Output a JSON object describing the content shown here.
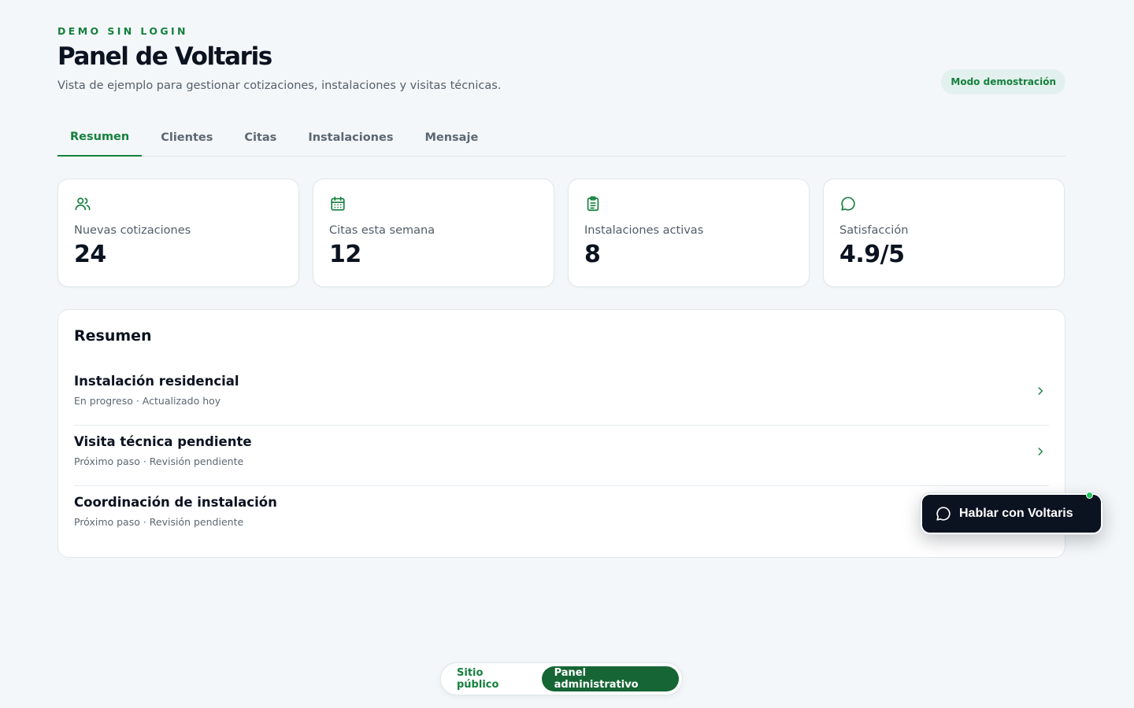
{
  "header": {
    "eyebrow": "DEMO SIN LOGIN",
    "title": "Panel de Voltaris",
    "subtitle": "Vista de ejemplo para gestionar cotizaciones, instalaciones y visitas técnicas.",
    "mode_badge": "Modo demostración"
  },
  "tabs": [
    {
      "label": "Resumen",
      "active": true
    },
    {
      "label": "Clientes",
      "active": false
    },
    {
      "label": "Citas",
      "active": false
    },
    {
      "label": "Instalaciones",
      "active": false
    },
    {
      "label": "Mensaje",
      "active": false
    }
  ],
  "stats": [
    {
      "icon": "users-icon",
      "label": "Nuevas cotizaciones",
      "value": "24"
    },
    {
      "icon": "calendar-icon",
      "label": "Citas esta semana",
      "value": "12"
    },
    {
      "icon": "clipboard-icon",
      "label": "Instalaciones activas",
      "value": "8"
    },
    {
      "icon": "chat-icon",
      "label": "Satisfacción",
      "value": "4.9/5"
    }
  ],
  "summary": {
    "title": "Resumen",
    "items": [
      {
        "title": "Instalación residencial",
        "subtitle": "En progreso · Actualizado hoy"
      },
      {
        "title": "Visita técnica pendiente",
        "subtitle": "Próximo paso · Revisión pendiente"
      },
      {
        "title": "Coordinación de instalación",
        "subtitle": "Próximo paso · Revisión pendiente"
      }
    ]
  },
  "chat_button": {
    "label": "Hablar con Voltaris",
    "icon": "chat-icon"
  },
  "view_switcher": {
    "public_label": "Sitio público",
    "admin_label": "Panel administrativo",
    "active": "admin"
  },
  "colors": {
    "accent": "#15803d",
    "accent_dark": "#166534",
    "background": "#f3f7f9",
    "text": "#0b1220",
    "online": "#22c55e"
  }
}
